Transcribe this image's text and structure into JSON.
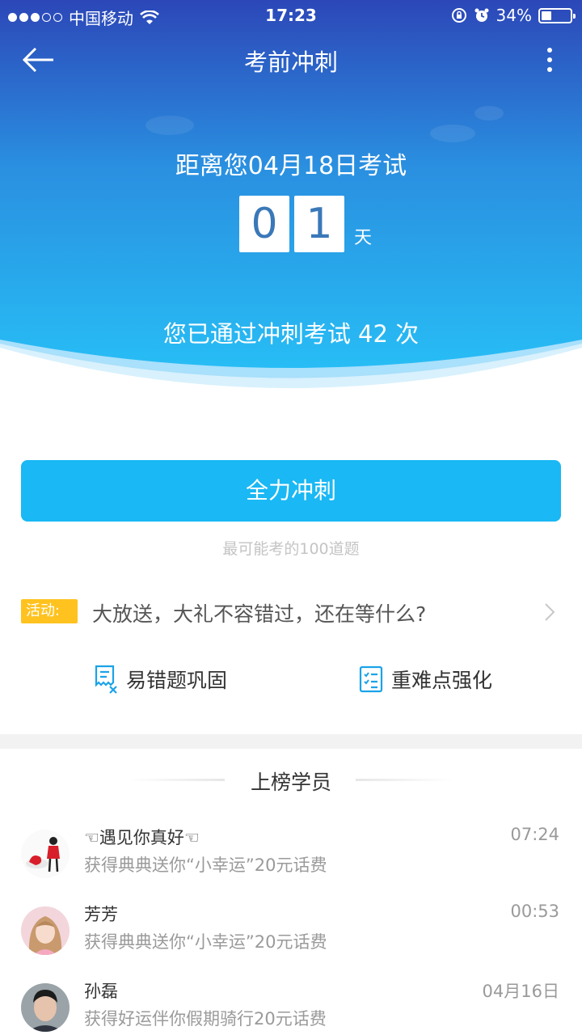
{
  "status_bar": {
    "carrier": "中国移动",
    "time": "17:23",
    "battery": "34%",
    "battery_level": 0.34
  },
  "nav": {
    "title": "考前冲刺"
  },
  "hero": {
    "exam_text": "距离您04月18日考试",
    "days_digits": [
      "0",
      "1"
    ],
    "day_unit": "天",
    "passed_text": "您已通过冲刺考试 42 次"
  },
  "main_action": {
    "label": "全力冲刺",
    "subtitle": "最可能考的100道题"
  },
  "activity": {
    "badge": "活动:",
    "text": "大放送，大礼不容错过，还在等什么?"
  },
  "quick_links": [
    {
      "label": "易错题巩固",
      "icon": "error-notes-icon"
    },
    {
      "label": "重难点强化",
      "icon": "checklist-icon"
    }
  ],
  "ranking": {
    "title": "上榜学员",
    "items": [
      {
        "name": "☜遇见你真好☜",
        "desc": "获得典典送你“小幸运”20元话费",
        "time": "07:24"
      },
      {
        "name": "芳芳",
        "desc": "获得典典送你“小幸运”20元话费",
        "time": "00:53"
      },
      {
        "name": "孙磊",
        "desc": "获得好运伴你假期骑行20元话费",
        "time": "04月16日"
      }
    ]
  },
  "colors": {
    "hero_top": "#2a4fbd",
    "hero_bottom": "#27b8f2",
    "primary_button": "#1ab8f4",
    "activity_badge": "#ffc21f"
  }
}
